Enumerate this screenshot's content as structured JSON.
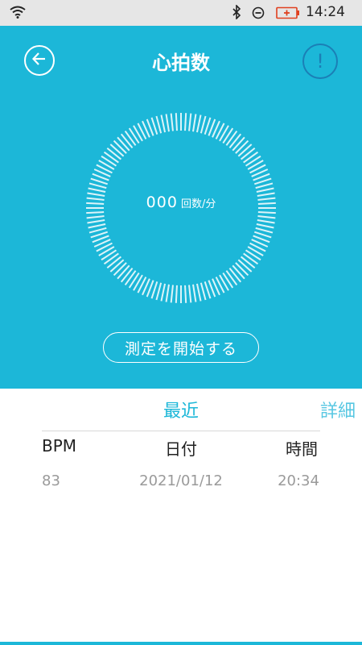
{
  "status_bar": {
    "time": "14:24",
    "icons": [
      "wifi-icon",
      "bluetooth-icon",
      "do-not-disturb-icon",
      "battery-charging-icon"
    ]
  },
  "header": {
    "title": "心拍数",
    "back_icon": "arrow-left-icon",
    "info_icon": "exclamation-icon",
    "info_symbol": "!"
  },
  "measurement": {
    "value": "000",
    "unit": "回数/分"
  },
  "start_button": {
    "label": "測定を開始する"
  },
  "tabs": {
    "recent": "最近",
    "detail": "詳細"
  },
  "table": {
    "columns": [
      "BPM",
      "日付",
      "時間"
    ],
    "rows": [
      {
        "bpm": "83",
        "date": "2021/01/12",
        "time": "20:34"
      }
    ]
  },
  "colors": {
    "accent": "#1cb7d8",
    "info_button": "#1b7fb6",
    "muted_text": "#9a9a9a"
  }
}
